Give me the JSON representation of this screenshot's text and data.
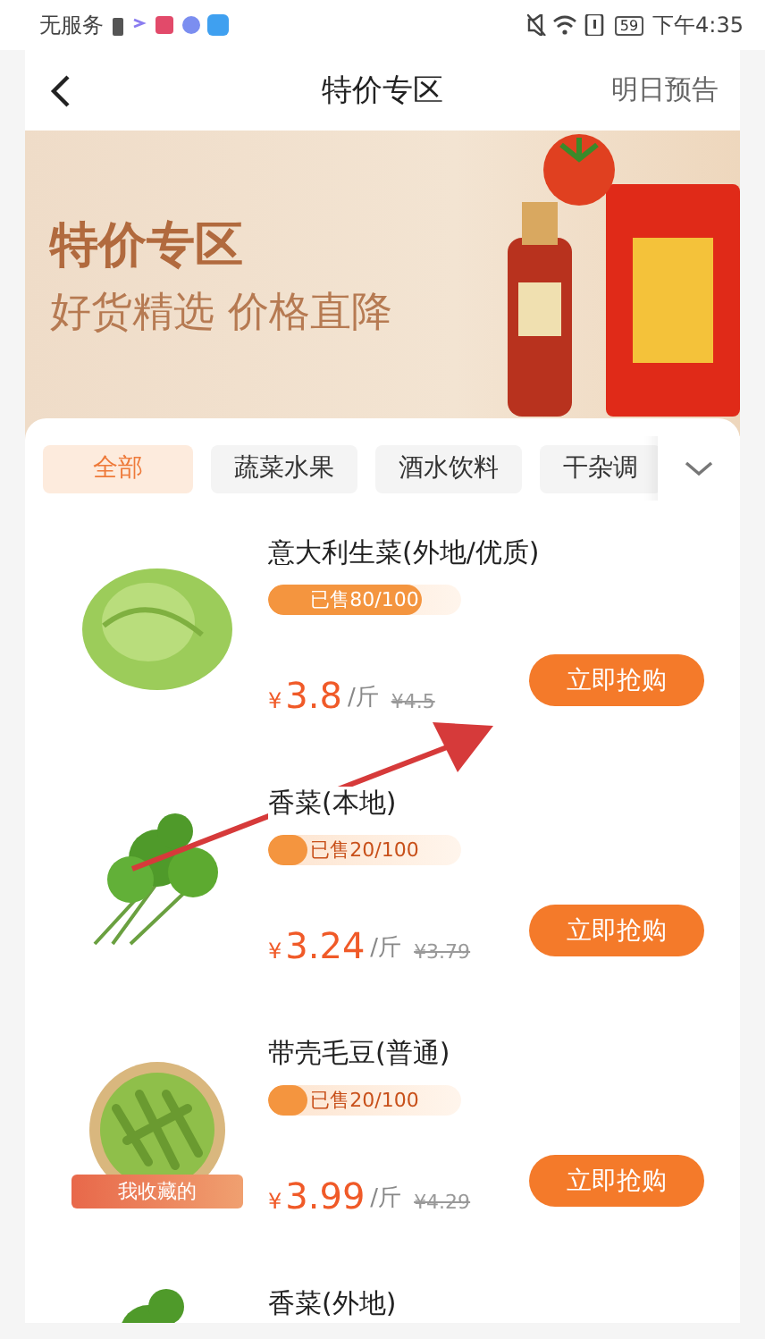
{
  "status_bar": {
    "carrier": "无服务",
    "battery": "59",
    "time": "下午4:35"
  },
  "header": {
    "title": "特价专区",
    "action": "明日预告"
  },
  "banner": {
    "title": "特价专区",
    "subtitle": "好货精选 价格直降"
  },
  "tabs": [
    {
      "label": "全部",
      "selected": true
    },
    {
      "label": "蔬菜水果",
      "selected": false
    },
    {
      "label": "酒水饮料",
      "selected": false
    },
    {
      "label": "干杂调",
      "selected": false
    }
  ],
  "products": [
    {
      "name": "意大利生菜(外地/优质)",
      "sold": "已售80/100",
      "level": 0.8,
      "currency": "¥",
      "price": "3.8",
      "unit": "/斤",
      "original_price": "¥4.5",
      "button": "立即抢购",
      "kind": "lettuce"
    },
    {
      "name": "香菜(本地)",
      "sold": "已售20/100",
      "level": 0.2,
      "currency": "¥",
      "price": "3.24",
      "unit": "/斤",
      "original_price": "¥3.79",
      "button": "立即抢购",
      "kind": "herb"
    },
    {
      "name": "带壳毛豆(普通)",
      "sold": "已售20/100",
      "level": 0.2,
      "currency": "¥",
      "price": "3.99",
      "unit": "/斤",
      "original_price": "¥4.29",
      "button": "立即抢购",
      "kind": "beans",
      "favorite_tag": "我收藏的"
    },
    {
      "name": "香菜(外地)",
      "kind": "herb"
    }
  ]
}
